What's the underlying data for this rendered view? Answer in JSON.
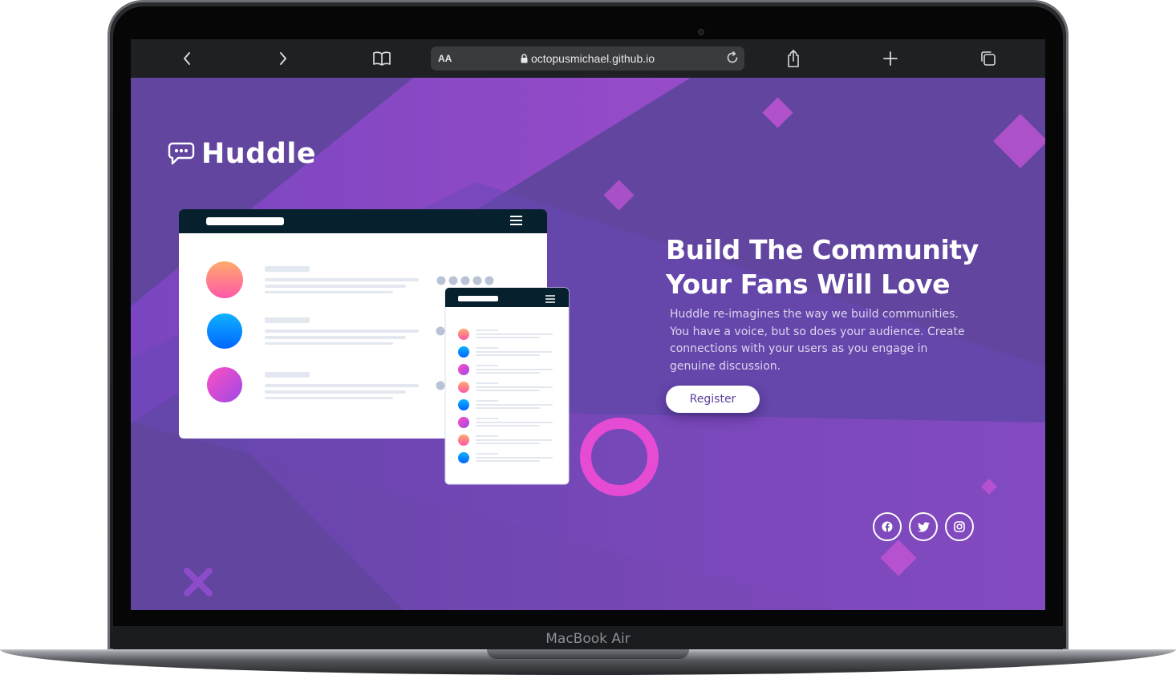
{
  "device": {
    "brand_label": "MacBook Air"
  },
  "browser": {
    "text_size_label": "AA",
    "url": "octopusmichael.github.io",
    "icons": [
      "back-icon",
      "forward-icon",
      "bookmarks-icon",
      "lock-icon",
      "reload-icon",
      "share-icon",
      "new-tab-icon",
      "tabs-icon"
    ]
  },
  "page": {
    "logo_text": "Huddle",
    "headline_line1": "Build The Community",
    "headline_line2": "Your Fans Will Love",
    "description": "Huddle re-imagines the way we build communities. You have a voice, but so does your audience. Create connections with your users as you engage in genuine discussion.",
    "register_label": "Register",
    "social_icons": [
      "facebook-icon",
      "twitter-icon",
      "instagram-icon"
    ]
  },
  "colors": {
    "background": "#61459f",
    "accent_magenta": "#d94fd1",
    "accent_pink": "#ff52c1",
    "mockup_header": "#07202e",
    "button_text": "#5a3f9a",
    "white": "#ffffff"
  }
}
